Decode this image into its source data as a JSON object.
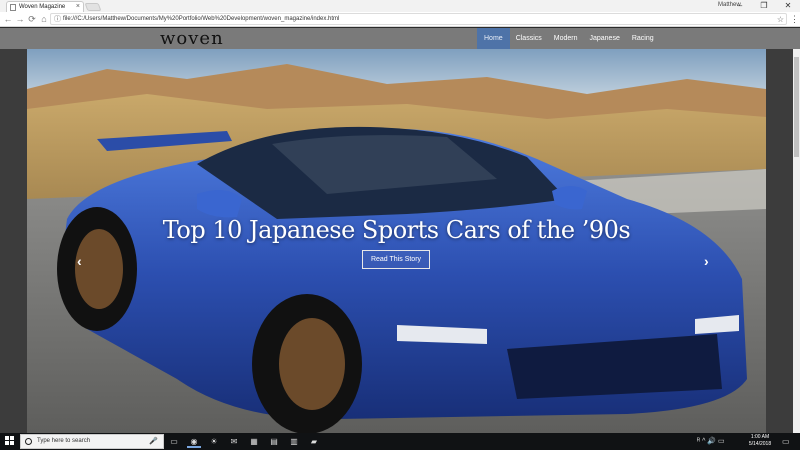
{
  "browser": {
    "tab_title": "Woven Magazine",
    "tab_close": "×",
    "profile_name": "Matthew",
    "window_minimize": "–",
    "window_maximize": "❐",
    "window_close": "✕",
    "back": "←",
    "forward": "→",
    "reload": "⟳",
    "home": "⌂",
    "info_icon": "ⓘ",
    "url": "file:///C:/Users/Matthew/Documents/My%20Portfolio/Web%20Development/woven_magazine/index.html",
    "star": "☆",
    "menu": "⋮"
  },
  "site": {
    "logo": "woven",
    "nav": [
      "Home",
      "Classics",
      "Modern",
      "Japanese",
      "Racing"
    ],
    "active_nav": "Home",
    "accent_color": "#4e73a8"
  },
  "hero": {
    "headline": "Top 10 Japanese Sports Cars of the ’90s",
    "button": "Read This Story",
    "prev_arrow": "‹",
    "next_arrow": "›",
    "car_color": "#2c4fb0"
  },
  "taskbar": {
    "search_placeholder": "Type here to search",
    "mic": "🎤",
    "apps": [
      "task-view",
      "chrome",
      "weather",
      "mail",
      "calendar",
      "notepad",
      "files",
      "explorer"
    ],
    "tray_icons": "ᴿ ^ 🔊 ▭",
    "time": "1:00 AM",
    "date": "5/14/2018",
    "notifications": "▭"
  }
}
